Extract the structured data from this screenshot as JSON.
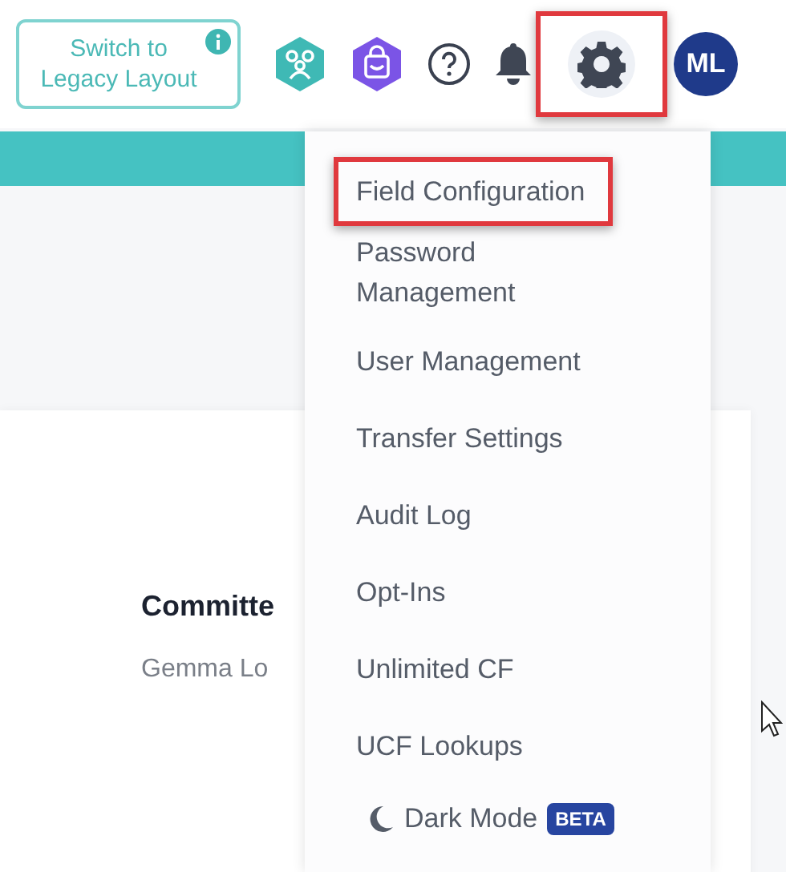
{
  "header": {
    "switch_button": {
      "label": "Switch to Legacy Layout"
    },
    "settings_button": {
      "highlighted": true
    },
    "avatar": {
      "initials": "ML"
    }
  },
  "card": {
    "title": "Committe",
    "subtitle": "Gemma Lo"
  },
  "settings_menu": {
    "items": [
      {
        "label": "Field Configuration",
        "highlighted": true
      },
      {
        "label": "Password Management",
        "highlighted": false
      },
      {
        "label": "User Management",
        "highlighted": false
      },
      {
        "label": "Transfer Settings",
        "highlighted": false
      },
      {
        "label": "Audit Log",
        "highlighted": false
      },
      {
        "label": "Opt-Ins",
        "highlighted": false
      },
      {
        "label": "Unlimited CF",
        "highlighted": false
      },
      {
        "label": "UCF Lookups",
        "highlighted": false
      }
    ],
    "dark_mode": {
      "label": "Dark Mode",
      "badge": "BETA"
    }
  }
}
